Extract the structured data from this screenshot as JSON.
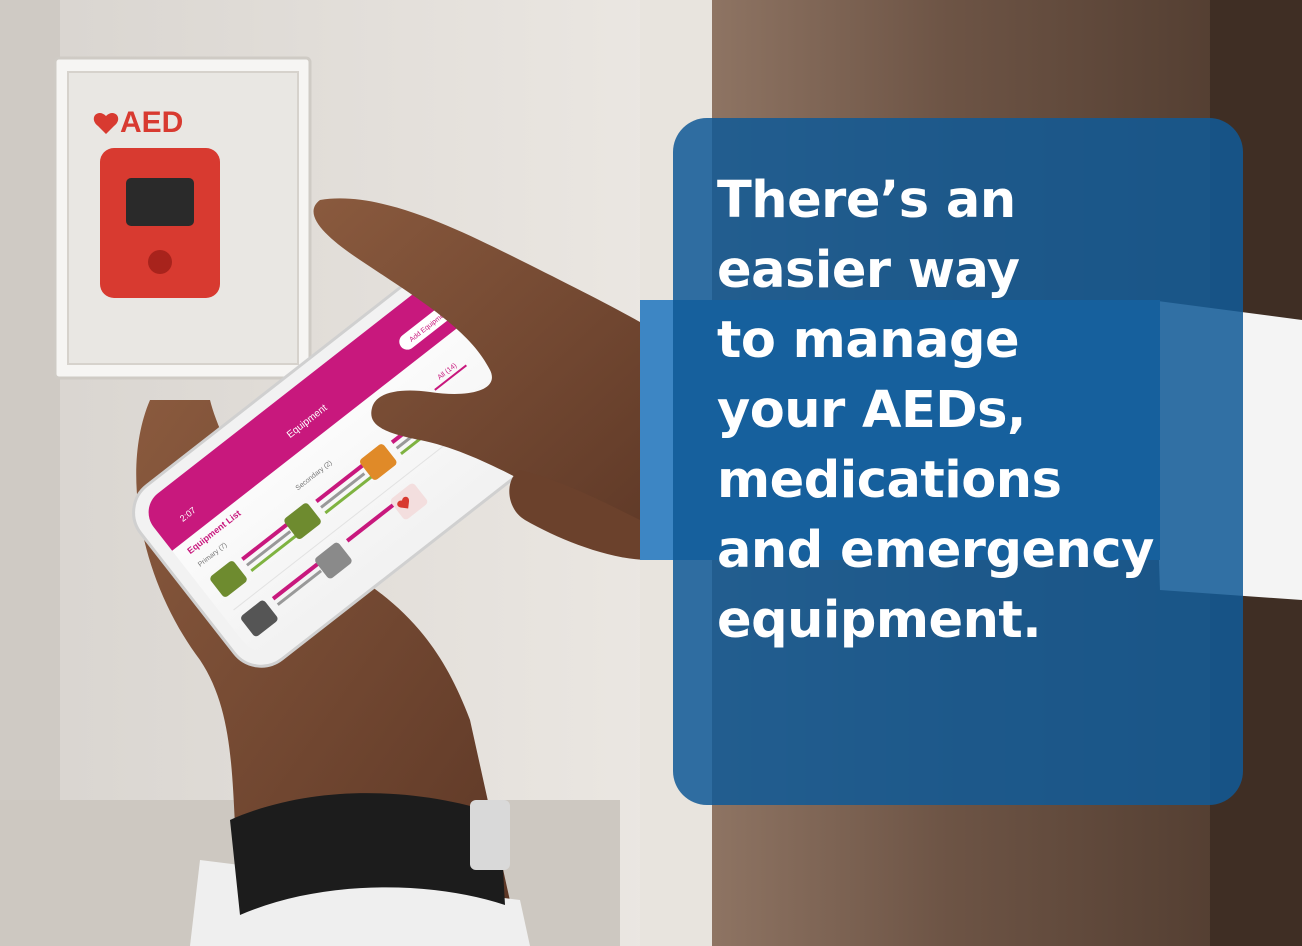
{
  "headline": {
    "lines": [
      "There’s an",
      "easier way",
      "to manage",
      "your AEDs,",
      "medications",
      "and emergency",
      "equipment."
    ]
  },
  "aed_cabinet": {
    "sign_text": "AED"
  },
  "phone_app": {
    "status_time": "2:07",
    "header_title": "Equipment",
    "add_button_label": "Add Equipment",
    "list_title": "Equipment List",
    "tabs": [
      "Primary (7)",
      "Secondary (2)",
      "All (14)"
    ]
  },
  "colors": {
    "callout_blue": "#105a96",
    "app_magenta": "#c8187d",
    "aed_red": "#d83a30"
  }
}
